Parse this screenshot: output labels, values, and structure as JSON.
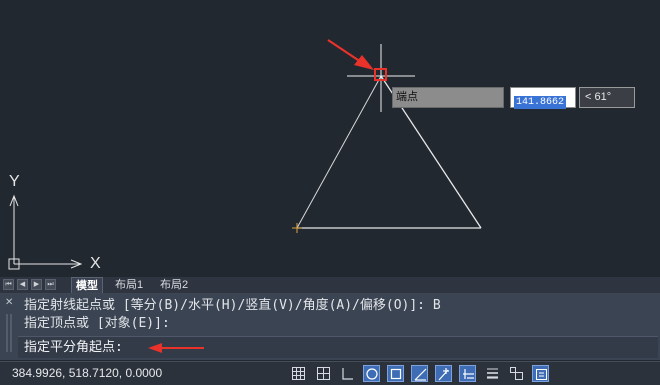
{
  "drawing": {
    "snap_tooltip": "端点",
    "length_value": "141.8662",
    "angle_value": "< 61°",
    "axis_x_label": "X",
    "axis_y_label": "Y"
  },
  "layout_tabs": {
    "nav_icons": [
      "first-tab-icon",
      "prev-tab-icon",
      "next-tab-icon",
      "last-tab-icon"
    ],
    "tabs": [
      {
        "label": "模型",
        "active": true
      },
      {
        "label": "布局1",
        "active": false
      },
      {
        "label": "布局2",
        "active": false
      }
    ]
  },
  "command": {
    "history": [
      "指定射线起点或 [等分(B)/水平(H)/竖直(V)/角度(A)/偏移(O)]: B",
      "指定顶点或 [对象(E)]:"
    ],
    "prompt": "指定平分角起点:"
  },
  "status": {
    "coordinates": "384.9926, 518.7120, 0.0000",
    "toggles": [
      {
        "name": "grid-display-icon",
        "on": false
      },
      {
        "name": "snap-grid-icon",
        "on": false
      },
      {
        "name": "ortho-icon",
        "on": false
      },
      {
        "name": "polar-tracking-icon",
        "on": true
      },
      {
        "name": "object-snap-icon",
        "on": true
      },
      {
        "name": "isometric-drafting-icon",
        "on": true
      },
      {
        "name": "object-snap-tracking-icon",
        "on": true
      },
      {
        "name": "dynamic-ucs-icon",
        "on": true
      },
      {
        "name": "lineweight-icon",
        "on": false
      },
      {
        "name": "selection-cycling-icon",
        "on": false
      },
      {
        "name": "annotation-monitor-icon",
        "on": true
      }
    ]
  },
  "colors": {
    "canvas": "#212830",
    "annotation_arrow": "#e8322a",
    "snap_marker": "#e8322a",
    "geometry": "#e6e6e6",
    "point_marker": "#d9a441",
    "toggle_on": "#3e6db5"
  }
}
